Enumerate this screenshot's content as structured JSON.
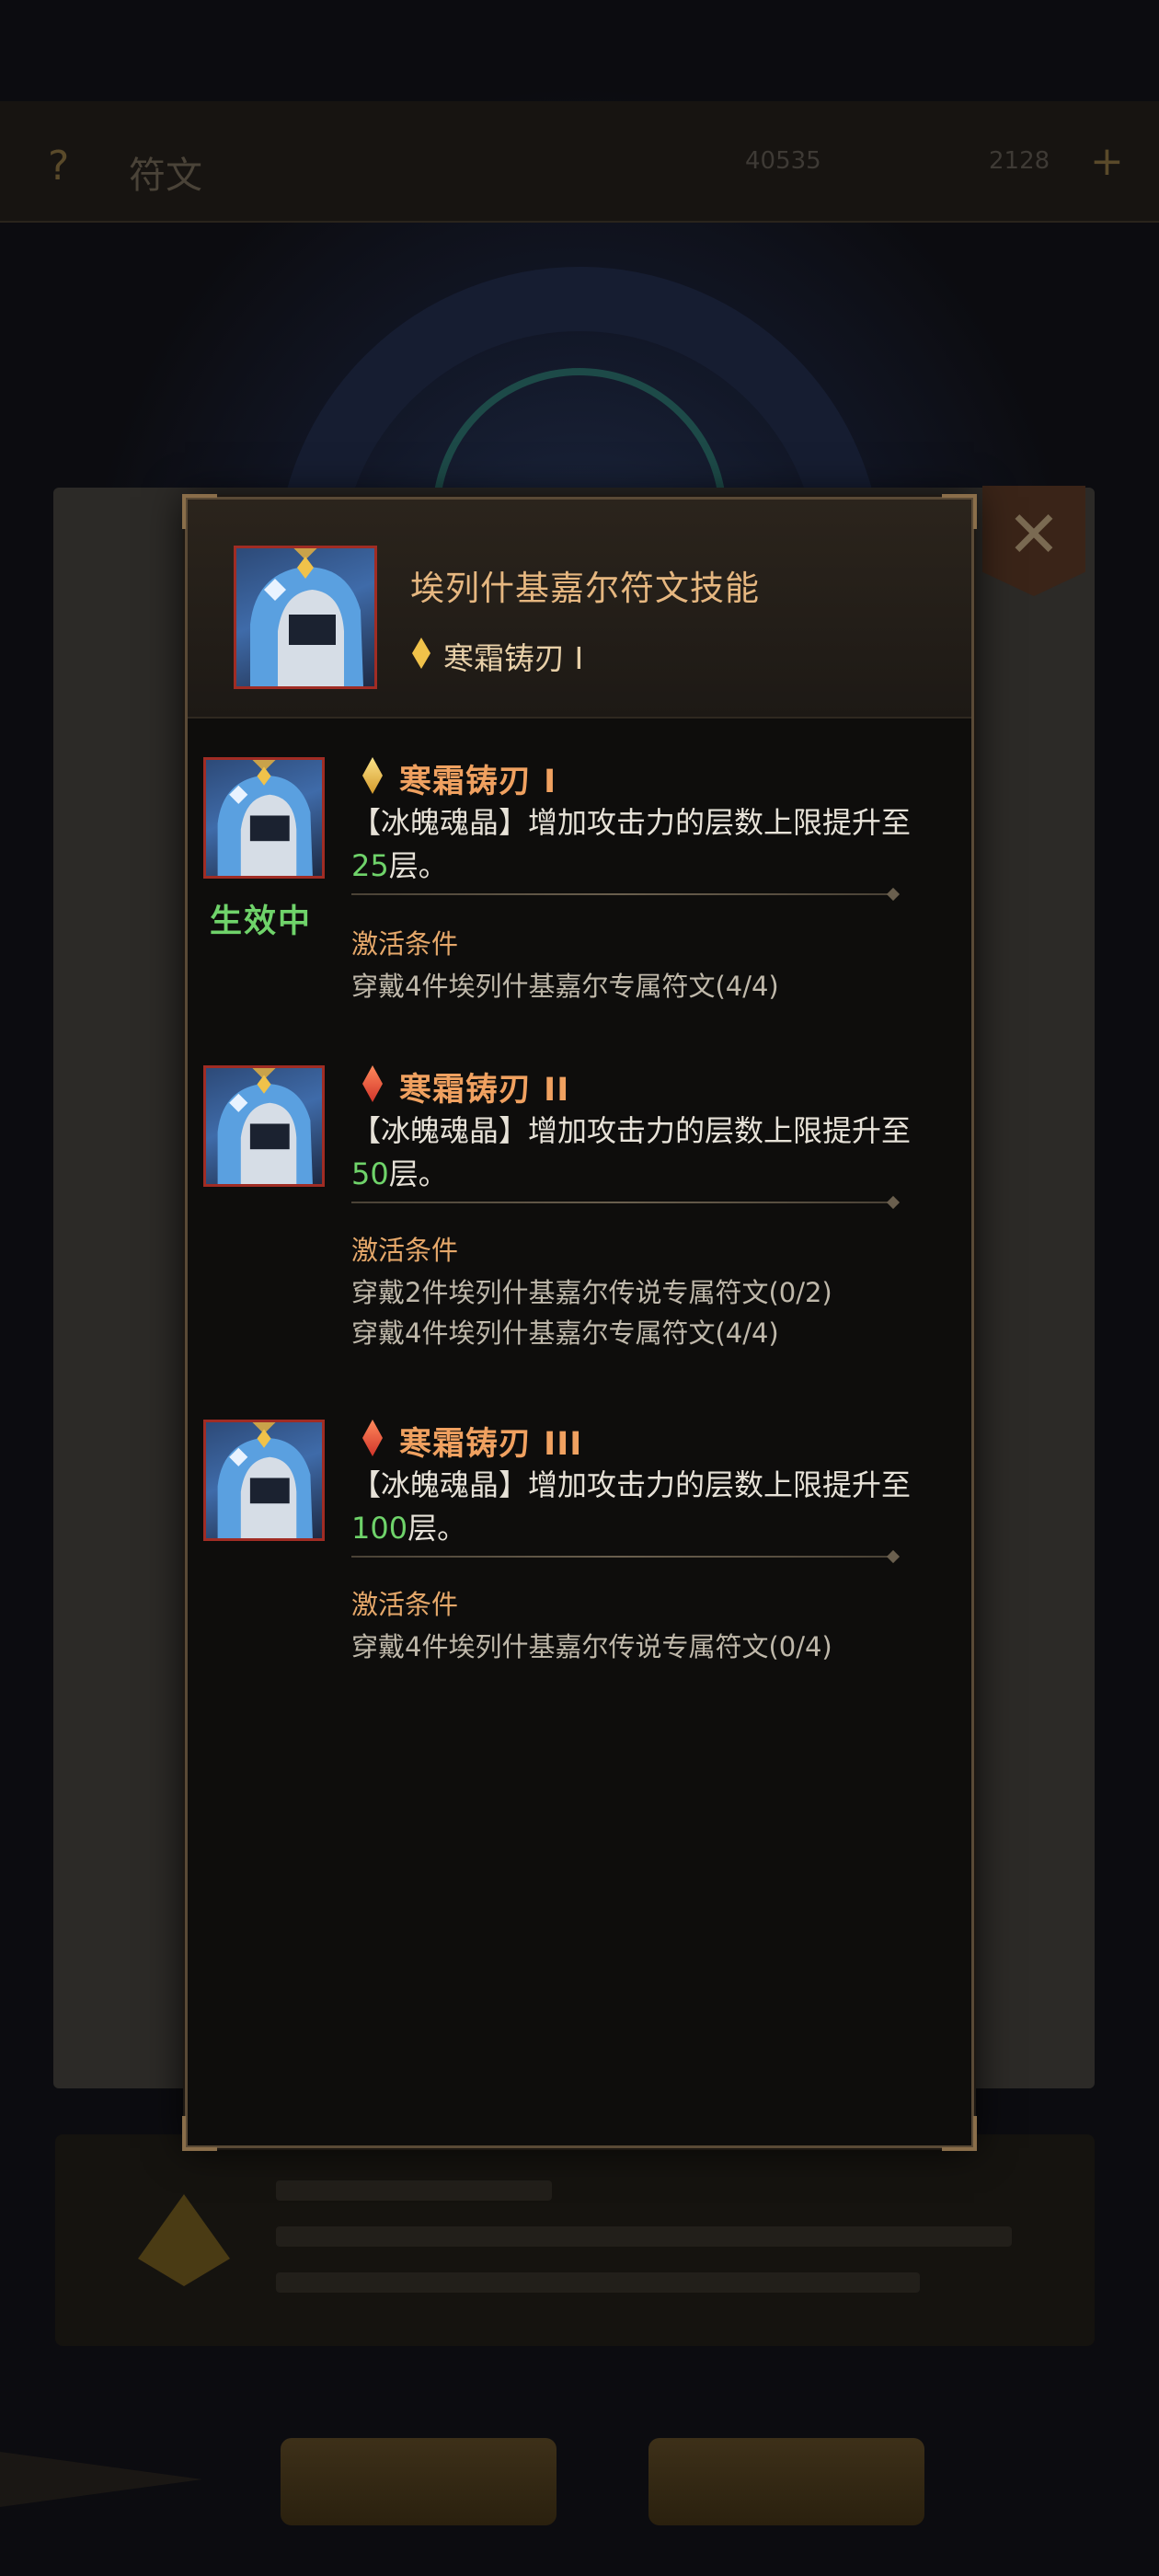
{
  "background": {
    "title": "符文",
    "resources": [
      "40535",
      "2128"
    ]
  },
  "popup": {
    "title": "埃列什基嘉尔符文技能",
    "current_skill": "寒霜铸刃 I",
    "skills": [
      {
        "name": "寒霜铸刃 I",
        "gem": "gold",
        "status": "生效中",
        "desc_prefix": "【冰魄魂晶】增加攻击力的层数上限提升至",
        "desc_value": "25",
        "desc_suffix": "层。",
        "cond_title": "激活条件",
        "conditions": [
          "穿戴4件埃列什基嘉尔专属符文(4/4)"
        ]
      },
      {
        "name": "寒霜铸刃 II",
        "gem": "red",
        "status": "",
        "desc_prefix": "【冰魄魂晶】增加攻击力的层数上限提升至",
        "desc_value": "50",
        "desc_suffix": "层。",
        "cond_title": "激活条件",
        "conditions": [
          "穿戴2件埃列什基嘉尔传说专属符文(0/2)",
          "穿戴4件埃列什基嘉尔专属符文(4/4)"
        ]
      },
      {
        "name": "寒霜铸刃 III",
        "gem": "red",
        "status": "",
        "desc_prefix": "【冰魄魂晶】增加攻击力的层数上限提升至",
        "desc_value": "100",
        "desc_suffix": "层。",
        "cond_title": "激活条件",
        "conditions": [
          "穿戴4件埃列什基嘉尔传说专属符文(0/4)"
        ]
      }
    ]
  },
  "colors": {
    "accent_orange": "#f0a160",
    "active_green": "#6fd36a",
    "frame_red": "#a02c24"
  },
  "icons": {
    "help": "help-icon",
    "close": "close-icon",
    "gem_gold": "diamond-gem-icon",
    "gem_red": "diamond-gem-icon",
    "portrait": "portrait-icon"
  }
}
